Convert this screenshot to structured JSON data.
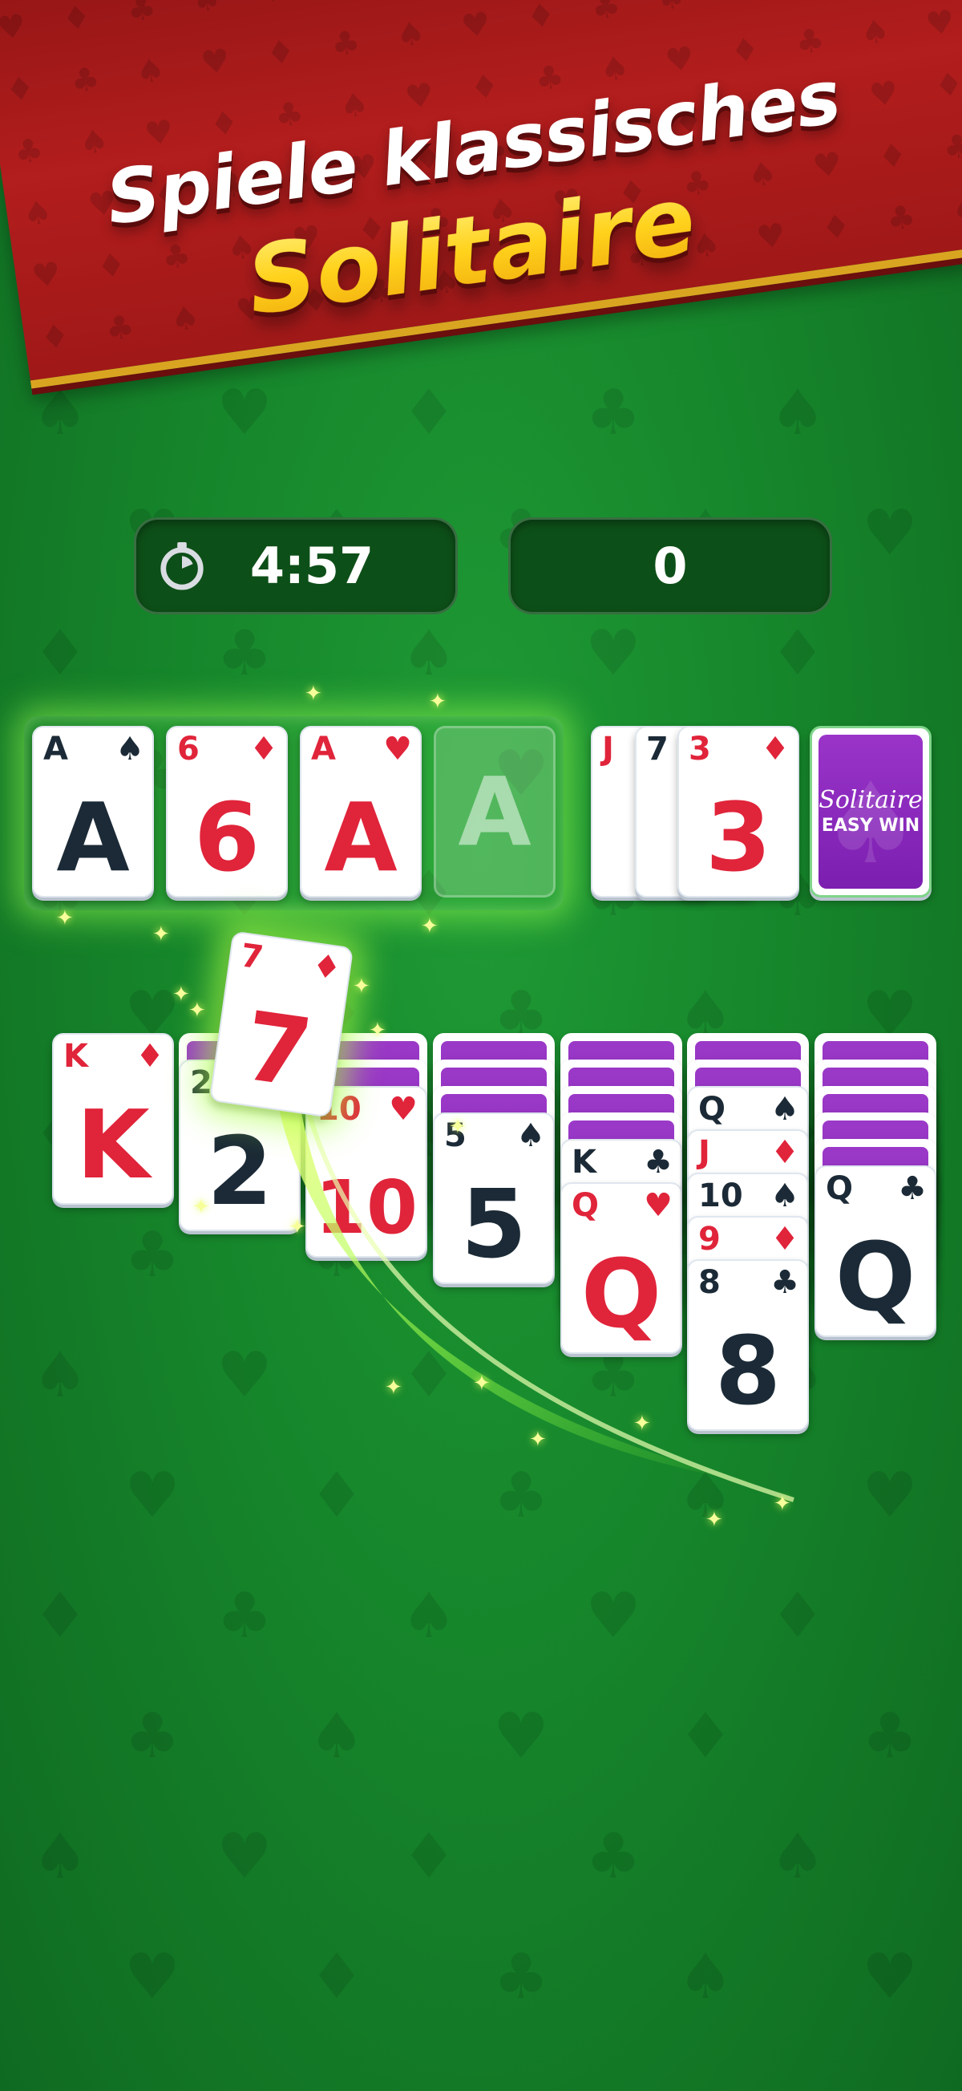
{
  "headline": {
    "line1": "Spiele klassisches",
    "line2": "Solitaire"
  },
  "hud": {
    "timer": "4:57",
    "score": "0"
  },
  "foundations": [
    {
      "rank": "A",
      "suit": "♠",
      "color": "black",
      "big": "A"
    },
    {
      "rank": "6",
      "suit": "♦",
      "color": "red",
      "big": "6"
    },
    {
      "rank": "A",
      "suit": "♥",
      "color": "red",
      "big": "A"
    },
    {
      "empty_label": "A"
    }
  ],
  "waste": [
    {
      "rank": "J",
      "color": "red"
    },
    {
      "rank": "7",
      "color": "black"
    },
    {
      "rank": "3",
      "suit": "♦",
      "color": "red",
      "big": "3"
    }
  ],
  "stock": {
    "line1": "Solitaire",
    "line2": "EASY WIN"
  },
  "flying_card": {
    "rank": "7",
    "suit": "♦",
    "color": "red",
    "big": "7"
  },
  "tableau": [
    {
      "hidden": 0,
      "cards": [
        {
          "rank": "K",
          "suit": "♦",
          "color": "red",
          "big": "K"
        }
      ]
    },
    {
      "hidden": 1,
      "cards": [
        {
          "rank": "2",
          "suit": "",
          "color": "black",
          "big": "2"
        }
      ]
    },
    {
      "hidden": 2,
      "cards": [
        {
          "rank": "10",
          "suit": "♥",
          "color": "red",
          "big": "10"
        }
      ]
    },
    {
      "hidden": 3,
      "cards": [
        {
          "rank": "5",
          "suit": "♠",
          "color": "black",
          "big": "5"
        }
      ]
    },
    {
      "hidden": 4,
      "cards": [
        {
          "rank": "K",
          "suit": "♣",
          "color": "black"
        },
        {
          "rank": "Q",
          "suit": "♥",
          "color": "red",
          "big": "Q"
        }
      ]
    },
    {
      "hidden": 2,
      "cards": [
        {
          "rank": "Q",
          "suit": "♠",
          "color": "black"
        },
        {
          "rank": "J",
          "suit": "♦",
          "color": "red"
        },
        {
          "rank": "10",
          "suit": "♠",
          "color": "black"
        },
        {
          "rank": "9",
          "suit": "♦",
          "color": "red"
        },
        {
          "rank": "8",
          "suit": "♣",
          "color": "black",
          "big": "8"
        }
      ]
    },
    {
      "hidden": 5,
      "cards": [
        {
          "rank": "Q",
          "suit": "♣",
          "color": "black",
          "big": "Q"
        }
      ]
    }
  ],
  "icons": {
    "timer": "stopwatch-icon"
  },
  "colors": {
    "felt": "#16862b",
    "banner": "#b21d1d",
    "gold": "#ffd21c",
    "card_back": "#8a2bbd",
    "red_suit": "#e0243a",
    "black_suit": "#1b2a36"
  }
}
